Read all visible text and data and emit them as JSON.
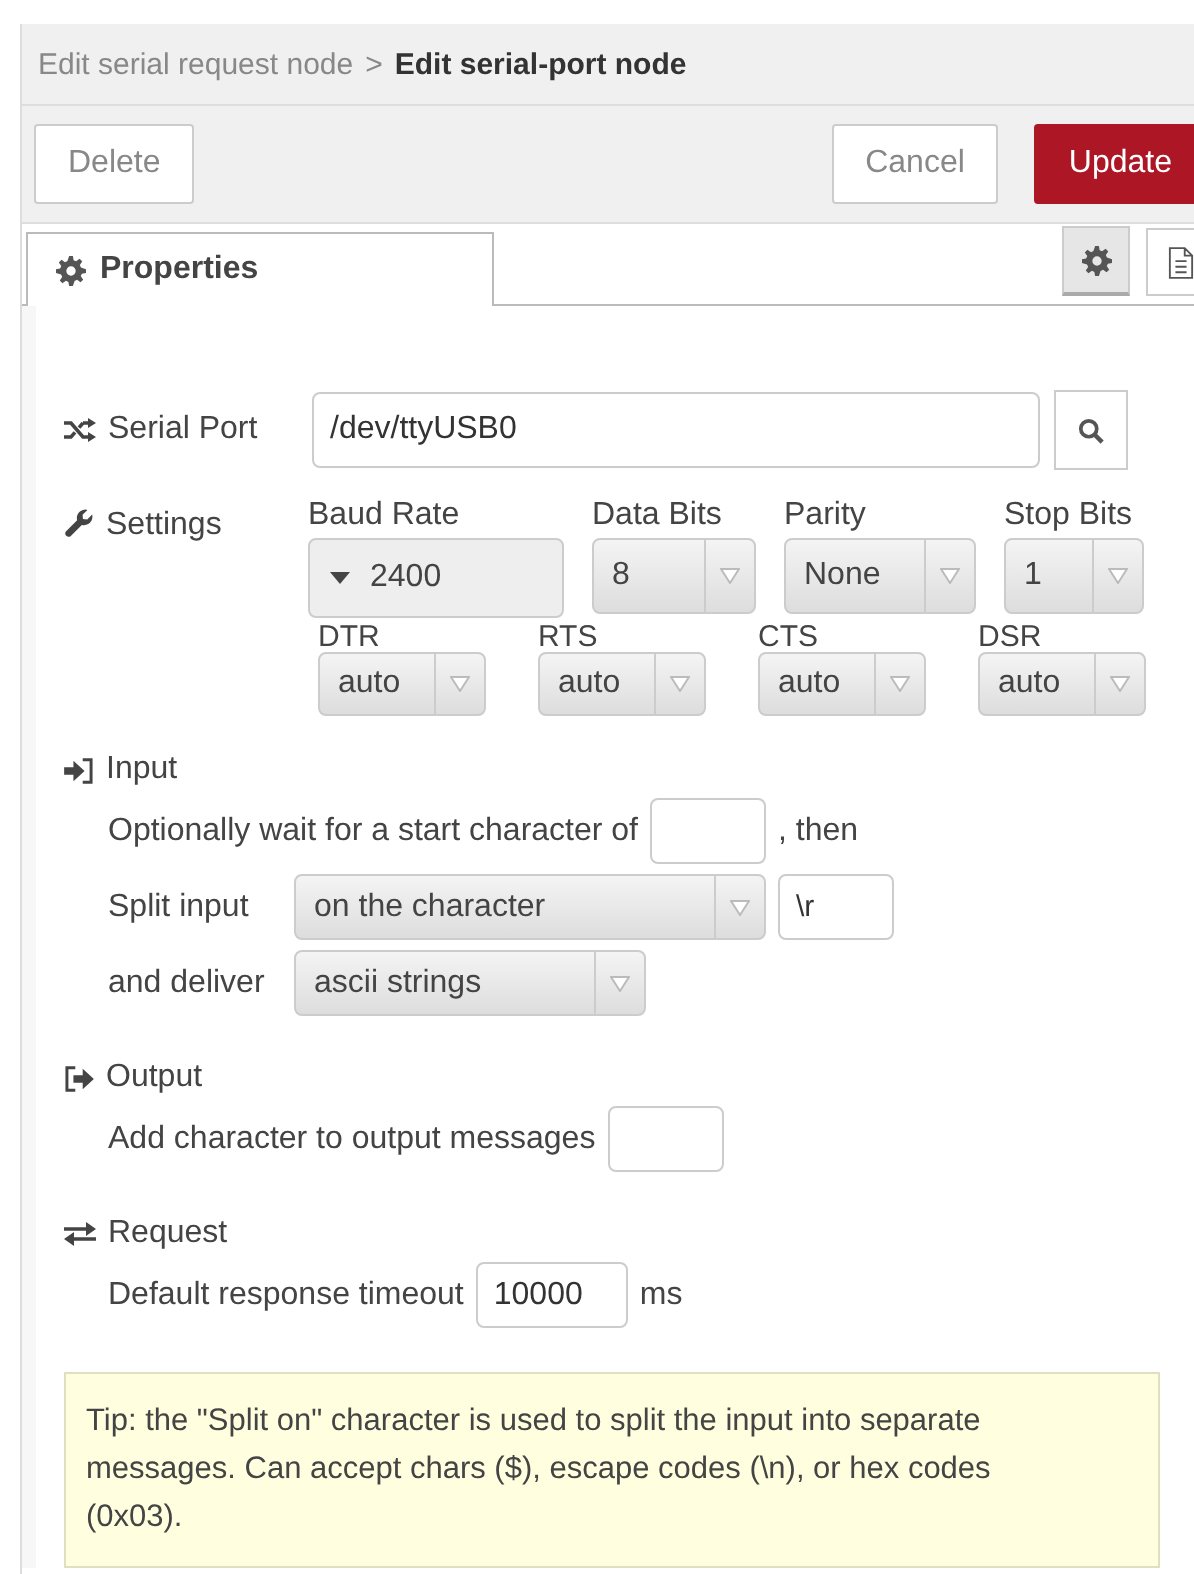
{
  "breadcrumb": {
    "parent": "Edit serial request node",
    "separator": ">",
    "current": "Edit serial-port node"
  },
  "buttons": [
    {
      "label": "Delete",
      "kind": "plain"
    },
    {
      "label": "Cancel",
      "kind": "plain"
    },
    {
      "label": "Update",
      "kind": "primary"
    }
  ],
  "tabs": [
    {
      "label": "Properties",
      "selected": true
    }
  ],
  "side_tabs": [
    {
      "kind": "settings",
      "selected": true
    },
    {
      "kind": "info",
      "selected": false
    }
  ],
  "serial_port": {
    "label": "Serial Port",
    "value": "/dev/ttyUSB0"
  },
  "settings": {
    "label": "Settings",
    "fields": [
      {
        "label": "Baud Rate",
        "value": "2400",
        "kind": "combo"
      },
      {
        "label": "Data Bits",
        "value": "8",
        "kind": "select"
      },
      {
        "label": "Parity",
        "value": "None",
        "kind": "select"
      },
      {
        "label": "Stop Bits",
        "value": "1",
        "kind": "select"
      }
    ],
    "lines": [
      {
        "label": "DTR",
        "value": "auto"
      },
      {
        "label": "RTS",
        "value": "auto"
      },
      {
        "label": "CTS",
        "value": "auto"
      },
      {
        "label": "DSR",
        "value": "auto"
      }
    ]
  },
  "input": {
    "heading": "Input",
    "wait_label": "Optionally wait for a start character of",
    "wait_suffix": ", then",
    "split_label": "Split input",
    "split_mode": "on the character",
    "split_value": "\\r",
    "deliver_label": "and deliver",
    "deliver_value": "ascii strings"
  },
  "output": {
    "heading": "Output",
    "add_label": "Add character to output messages"
  },
  "request": {
    "heading": "Request",
    "timeout_label": "Default response timeout",
    "timeout_value": "10000",
    "timeout_unit": "ms"
  },
  "tip": "Tip: the \"Split on\" character is used to split the input into separate messages. Can accept chars ($), escape codes (\\n), or hex codes (0x03)."
}
